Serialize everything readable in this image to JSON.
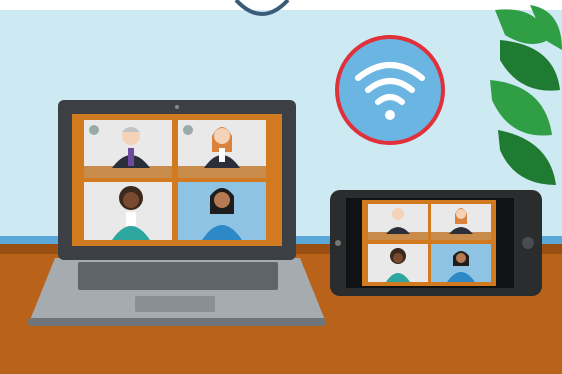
{
  "scene": {
    "description_icons": {
      "wifi": "wifi-icon",
      "crest": "crest-icon",
      "plant": "plant-icon"
    },
    "colors": {
      "wall": "#cde9f2",
      "desk": "#b8621a",
      "desk_edge": "#9a4f12",
      "frame_orange": "#d27a1f",
      "laptop_body": "#8a8f93",
      "laptop_screen_bezel": "#3c4044",
      "phone_body": "#2a2c2e",
      "wifi_circle": "#5aa7d8",
      "wifi_ring": "#e0313b",
      "plant_green": "#2f9e44",
      "plant_dark": "#1f7a32",
      "skin_light": "#f4d3b8",
      "skin_dark": "#7a4a2e",
      "suit_dark": "#2b2f3a",
      "hair_red": "#d9833c",
      "hair_grey": "#c2c2c2",
      "tile_bg_light": "#e9e9e9",
      "tile_bg_blue": "#8fc3e3"
    }
  }
}
